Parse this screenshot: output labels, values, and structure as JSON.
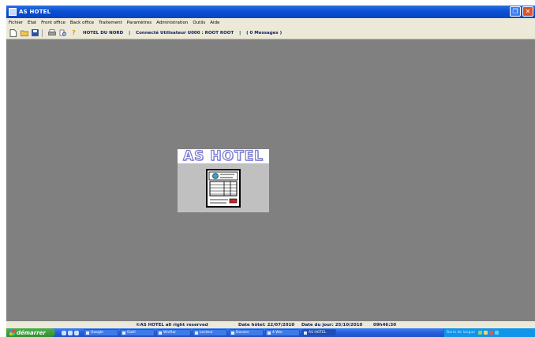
{
  "window": {
    "title": "AS HOTEL",
    "buttons": [
      "restore",
      "close"
    ]
  },
  "menu": [
    "Fichier",
    "Etat",
    "Front office",
    "Back office",
    "Traitement",
    "Paramètres",
    "Administration",
    "Outils",
    "Aide"
  ],
  "toolbar": {
    "icons": [
      "new-document-icon",
      "open-folder-icon",
      "save-icon",
      "print-icon",
      "print-preview-icon",
      "help-icon"
    ],
    "hotel": "HOTEL DU NORD",
    "sep1": "|",
    "user": "Connecté Utilisateur U000 : ROOT ROOT",
    "sep2": "|",
    "messages": "( 0 Messages )"
  },
  "splash": {
    "logo": "AS HOTEL"
  },
  "status": {
    "copyright": "©AS HOTEL all right reserved",
    "date_hotel": "Date hôtel: 22/07/2010",
    "date_jour": "Date du jour: 25/10/2010",
    "time": "09h46:30"
  },
  "taskbar": {
    "start": "démarrer",
    "tasks": [
      "Google",
      "Outil",
      "WinRar",
      "Lecteur",
      "Dossier",
      "4 Wor",
      "AS HOTEL"
    ],
    "tray_text": "Barre de langue"
  },
  "colors": {
    "desktop": "#808080",
    "titlebar": "#0a4fd3",
    "taskbar": "#245edc",
    "start": "#2f8f2f",
    "logo": "#7a7ad0"
  }
}
